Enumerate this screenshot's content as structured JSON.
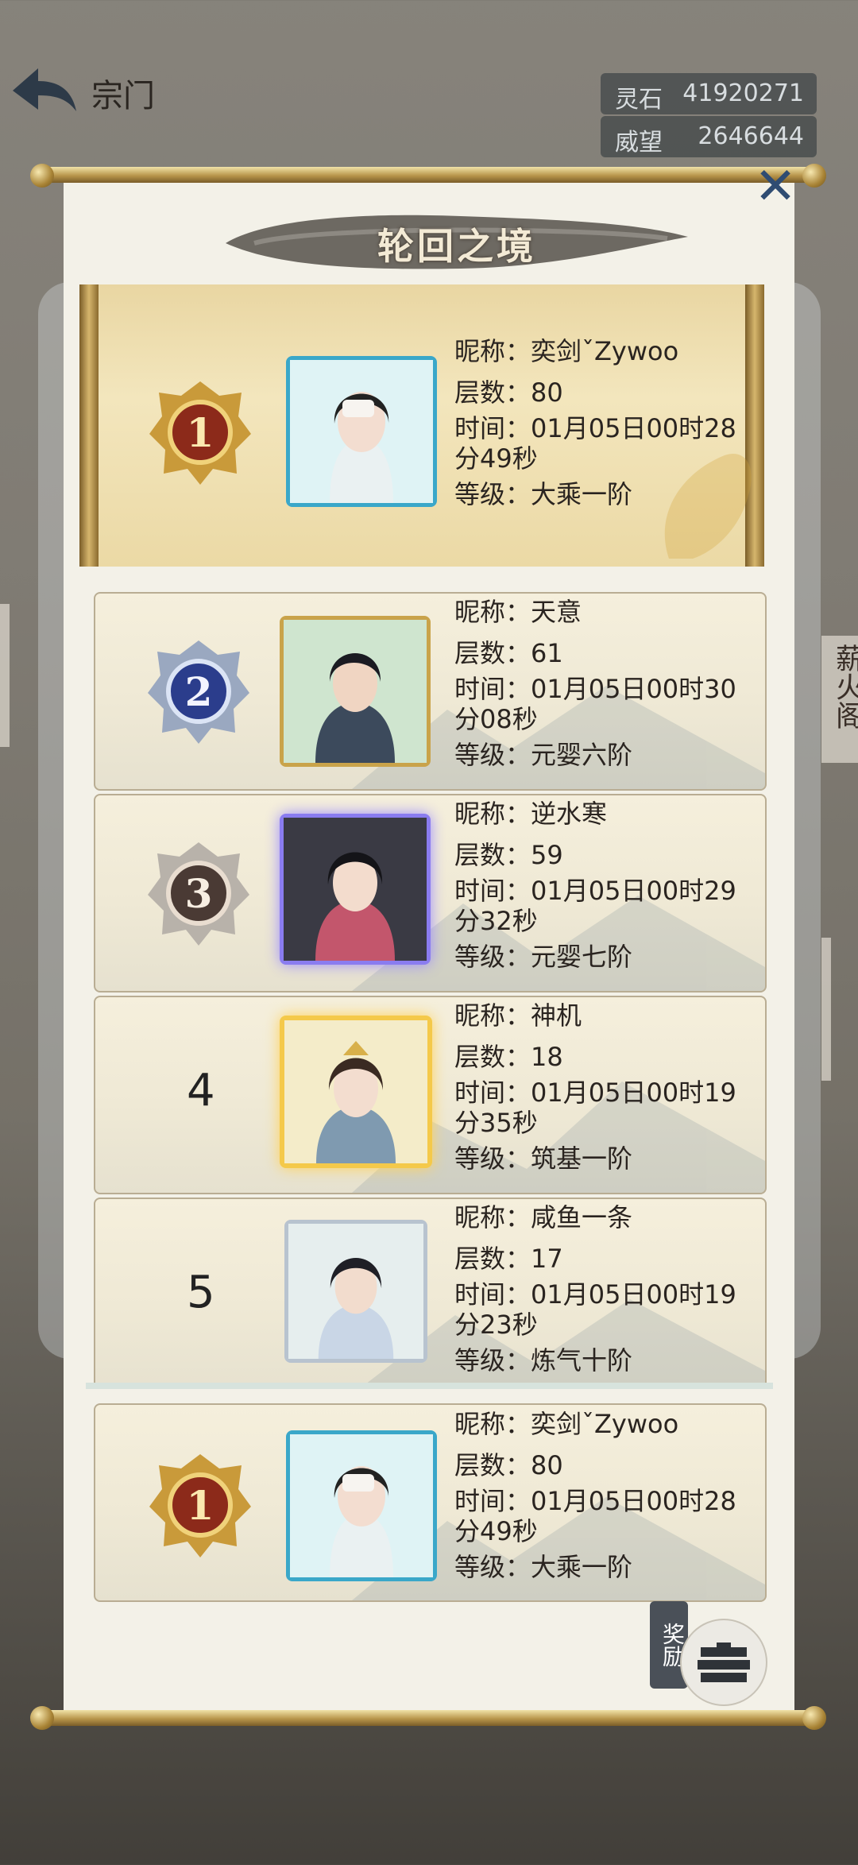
{
  "header": {
    "title": "宗门"
  },
  "resources": [
    {
      "label": "灵石",
      "value": "41920271"
    },
    {
      "label": "威望",
      "value": "2646644"
    }
  ],
  "side_tabs": {
    "right_top": "薪火阁"
  },
  "panel": {
    "title": "轮回之境"
  },
  "rankings": [
    {
      "rank": "1",
      "nickname": "昵称：奕剑ˇZywoo",
      "floors": "层数：80",
      "time": "时间：01月05日00时28分49秒",
      "level": "等级：大乘一阶"
    },
    {
      "rank": "2",
      "nickname": "昵称：天意",
      "floors": "层数：61",
      "time": "时间：01月05日00时30分08秒",
      "level": "等级：元婴六阶"
    },
    {
      "rank": "3",
      "nickname": "昵称：逆水寒",
      "floors": "层数：59",
      "time": "时间：01月05日00时29分32秒",
      "level": "等级：元婴七阶"
    },
    {
      "rank": "4",
      "nickname": "昵称：神机",
      "floors": "层数：18",
      "time": "时间：01月05日00时19分35秒",
      "level": "等级：筑基一阶"
    },
    {
      "rank": "5",
      "nickname": "昵称：咸鱼一条",
      "floors": "层数：17",
      "time": "时间：01月05日00时19分23秒",
      "level": "等级：炼气十阶"
    }
  ],
  "my_rank": {
    "rank": "1",
    "nickname": "昵称：奕剑ˇZywoo",
    "floors": "层数：80",
    "time": "时间：01月05日00时28分49秒",
    "level": "等级：大乘一阶"
  },
  "reward": {
    "label": "奖励"
  }
}
